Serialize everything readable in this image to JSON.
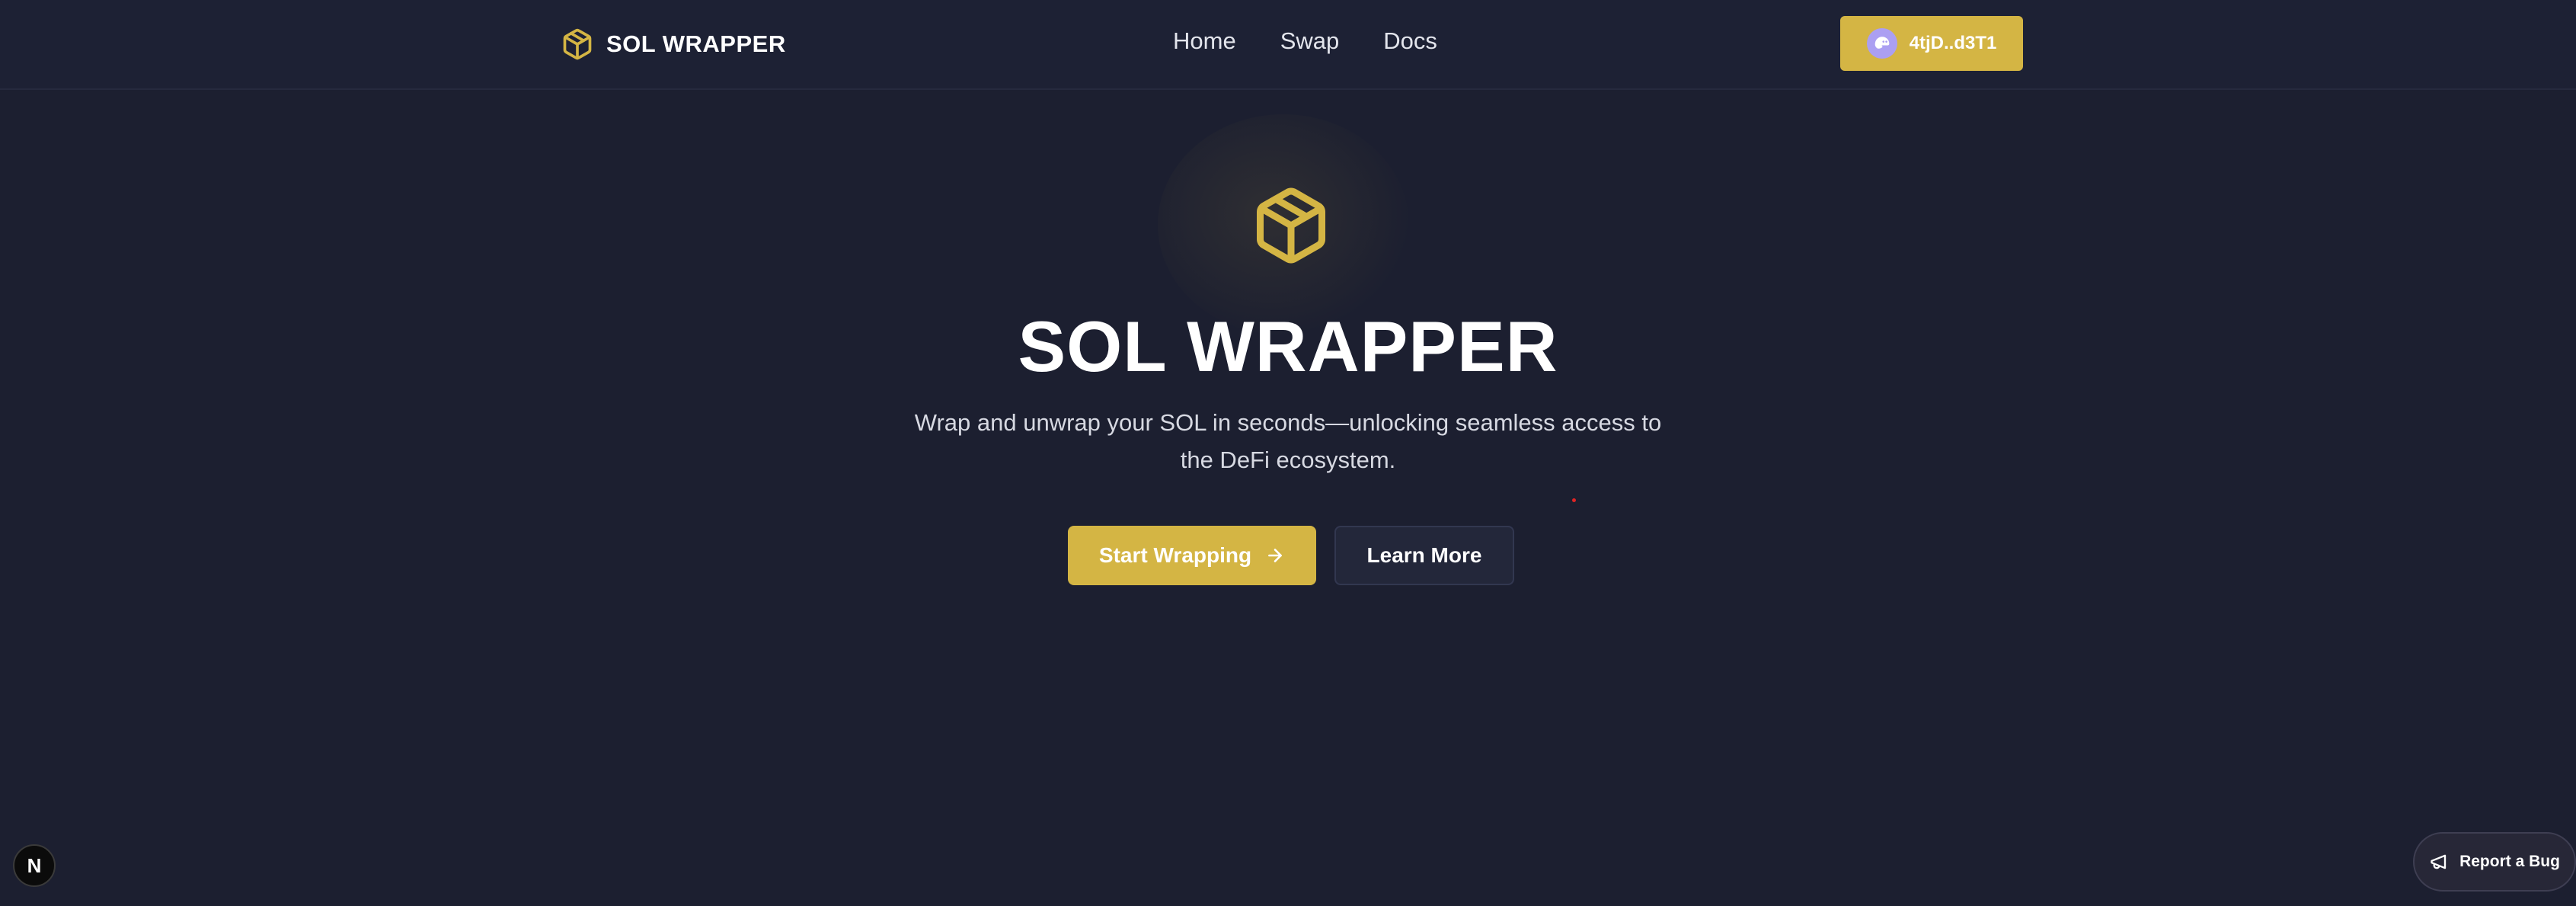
{
  "colors": {
    "background": "#1c1f30",
    "header_background": "#1d2134",
    "accent": "#d4b544",
    "secondary_button": "#23273a",
    "wallet_avatar": "#ab9ff2"
  },
  "header": {
    "brand_icon": "package-icon",
    "brand_name": "SOL WRAPPER",
    "nav": [
      {
        "label": "Home"
      },
      {
        "label": "Swap"
      },
      {
        "label": "Docs"
      }
    ],
    "wallet": {
      "avatar_icon": "phantom-ghost-icon",
      "address": "4tjD..d3T1"
    }
  },
  "hero": {
    "icon": "package-icon",
    "title": "SOL WRAPPER",
    "subtitle": "Wrap and unwrap your SOL in seconds—unlocking seamless access to the DeFi ecosystem.",
    "primary_button": {
      "label": "Start Wrapping",
      "icon": "arrow-right-icon"
    },
    "secondary_button": {
      "label": "Learn More"
    }
  },
  "widgets": {
    "next_badge_letter": "N",
    "report_bug": {
      "label": "Report a Bug",
      "icon": "megaphone-icon"
    }
  }
}
